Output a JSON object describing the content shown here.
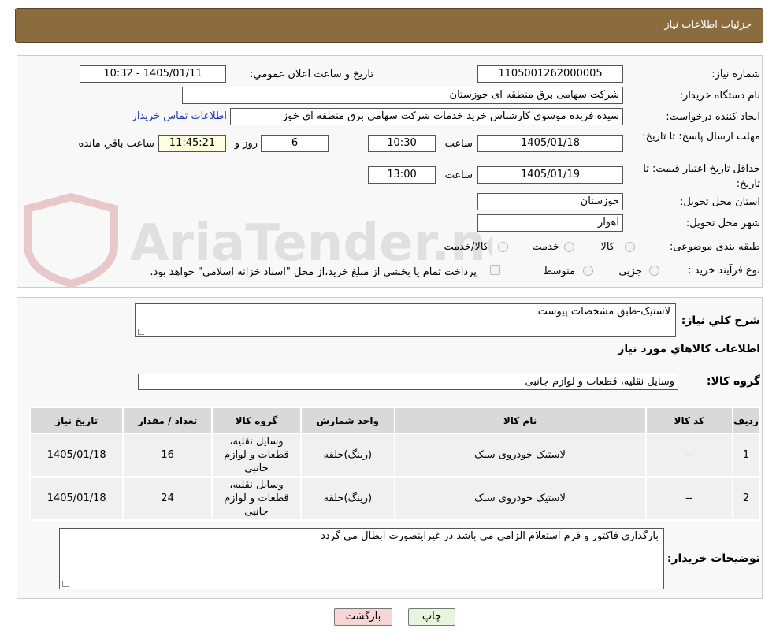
{
  "header": {
    "title": "جزئیات اطلاعات نیاز"
  },
  "labels": {
    "need_number": "شماره نیاز:",
    "announce_datetime": "تاریخ و ساعت اعلان عمومي:",
    "buyer_org": "نام دستگاه خريدار:",
    "requester": "ايجاد کننده درخواست:",
    "contact_link": "اطلاعات تماس خریدار",
    "deadline": "مهلت ارسال پاسخ: تا تاريخ:",
    "hour": "ساعت",
    "day_and": "روز و",
    "hours_left": "ساعت باقي مانده",
    "validity": "حداقل تاريخ اعتبار قيمت: تا تاريخ:",
    "hour2": "ساعت",
    "province": "استان محل تحويل:",
    "city": "شهر محل تحويل:",
    "category": "طبقه بندی موضوعی:",
    "process_type": "نوع فرآيند خريد :",
    "general_desc": "شرح کلي نياز:",
    "goods_info": "اطلاعات کالاهاي مورد نياز",
    "goods_group": "گروه کالا:",
    "buyer_notes": "توضيحات خريدار:"
  },
  "values": {
    "need_number": "1105001262000005",
    "announce_datetime": "1405/01/11 - 10:32",
    "buyer_org": "شرکت سهامی برق منطقه ای خوزستان",
    "requester": "سیده فریده موسوی کارشناس خرید خدمات شرکت سهامی برق منطقه ای خوز",
    "deadline_date": "1405/01/18",
    "deadline_time": "10:30",
    "days_left": "6",
    "time_left": "11:45:21",
    "validity_date": "1405/01/19",
    "validity_time": "13:00",
    "province": "خوزستان",
    "city": "اهواز",
    "general_desc": "لاستیک-طبق مشخصات پیوست",
    "goods_group": "وسایل نقلیه، قطعات و لوازم جانبی",
    "buyer_notes": "بارگذاری فاکتور و فرم استعلام الزامی می باشد در غیراینصورت ابطال می گردد"
  },
  "category_options": {
    "goods": "کالا",
    "service": "خدمت",
    "goods_service": "کالا/خدمت"
  },
  "process_options": {
    "partial": "جزیی",
    "medium": "متوسط",
    "treasury_note": "پرداخت تمام یا بخشی از مبلغ خرید،از محل \"اسناد خزانه اسلامی\" خواهد بود."
  },
  "watermark": "AriaTender.neT",
  "table": {
    "headers": [
      "رديف",
      "کد کالا",
      "نام کالا",
      "واحد شمارش",
      "گروه کالا",
      "تعداد / مقدار",
      "تاريخ نياز"
    ],
    "rows": [
      [
        "1",
        "--",
        "لاستیک خودروی سبک",
        "(رینگ)حلقه",
        "وسایل نقلیه، قطعات و لوازم جانبی",
        "16",
        "1405/01/18"
      ],
      [
        "2",
        "--",
        "لاستیک خودروی سبک",
        "(رینگ)حلقه",
        "وسایل نقلیه، قطعات و لوازم جانبی",
        "24",
        "1405/01/18"
      ]
    ]
  },
  "buttons": {
    "print": "چاپ",
    "back": "بازگشت"
  },
  "colors": {
    "header_bg": "#8b6c3f",
    "back_btn": "#f8d6d6",
    "print_btn": "#e6f5de"
  }
}
